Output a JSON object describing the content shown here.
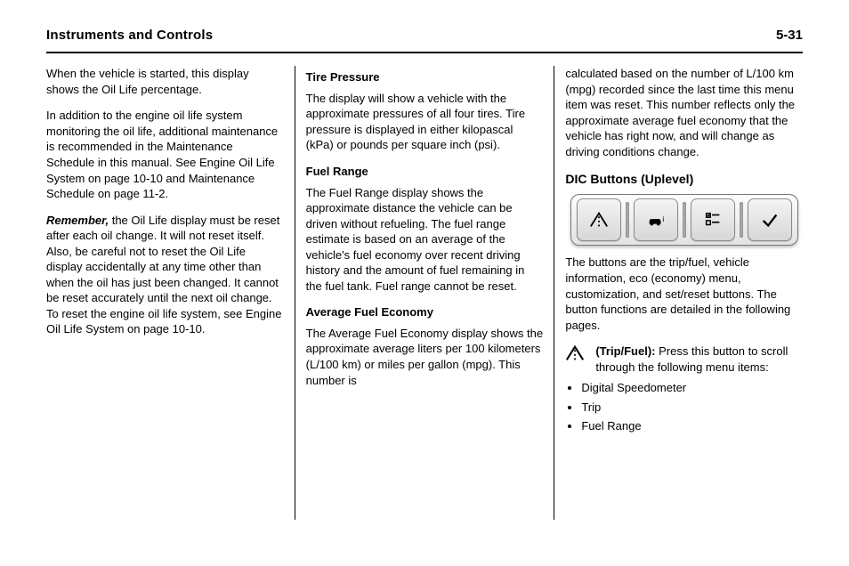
{
  "header": {
    "chapter": "Instruments and Controls",
    "page_number": "5-31"
  },
  "col1": {
    "p1": "When the vehicle is started, this display shows the Oil Life percentage.",
    "p2": "In addition to the engine oil life system monitoring the oil life, additional maintenance is recommended in the Maintenance Schedule in this manual. See Engine Oil Life System on page 10-10 and Maintenance Schedule on page 11-2.",
    "p3_label": "Remember,",
    "p3": "the Oil Life display must be reset after each oil change. It will not reset itself. Also, be careful not to reset the Oil Life display accidentally at any time other than when the oil has just been changed. It cannot be reset accurately until the next oil change. To reset the engine oil life system, see Engine Oil Life System on page 10-10."
  },
  "col2": {
    "h_tire": "Tire Pressure",
    "tire_p": "The display will show a vehicle with the approximate pressures of all four tires. Tire pressure is displayed in either kilopascal (kPa) or pounds per square inch (psi).",
    "h_fuel": "Fuel Range",
    "fuel_p": "The Fuel Range display shows the approximate distance the vehicle can be driven without refueling. The fuel range estimate is based on an average of the vehicle's fuel economy over recent driving history and the amount of fuel remaining in the fuel tank. Fuel range cannot be reset.",
    "h_afe": "Average Fuel Economy",
    "afe_p": "The Average Fuel Economy display shows the approximate average liters per 100 kilometers (L/100 km) or miles per gallon (mpg). This number is"
  },
  "col3": {
    "intro": "calculated based on the number of L/100 km (mpg) recorded since the last time this menu item was reset. This number reflects only the approximate average fuel economy that the vehicle has right now, and will change as driving conditions change.",
    "h_uplevel": "DIC Buttons (Uplevel)",
    "buttons": {
      "b1": "trip-road",
      "b2": "vehicle-info",
      "b3": "eco-options",
      "b4": "set-check"
    },
    "caption": "The buttons are the trip/fuel, vehicle information, eco (economy) menu, customization, and set/reset buttons. The button functions are detailed in the following pages.",
    "h_tripfuel": "(Trip/Fuel):",
    "tripfuel_p": "Press this button to scroll through the following menu items:",
    "items": [
      "Digital Speedometer",
      "Trip",
      "Fuel Range"
    ]
  }
}
